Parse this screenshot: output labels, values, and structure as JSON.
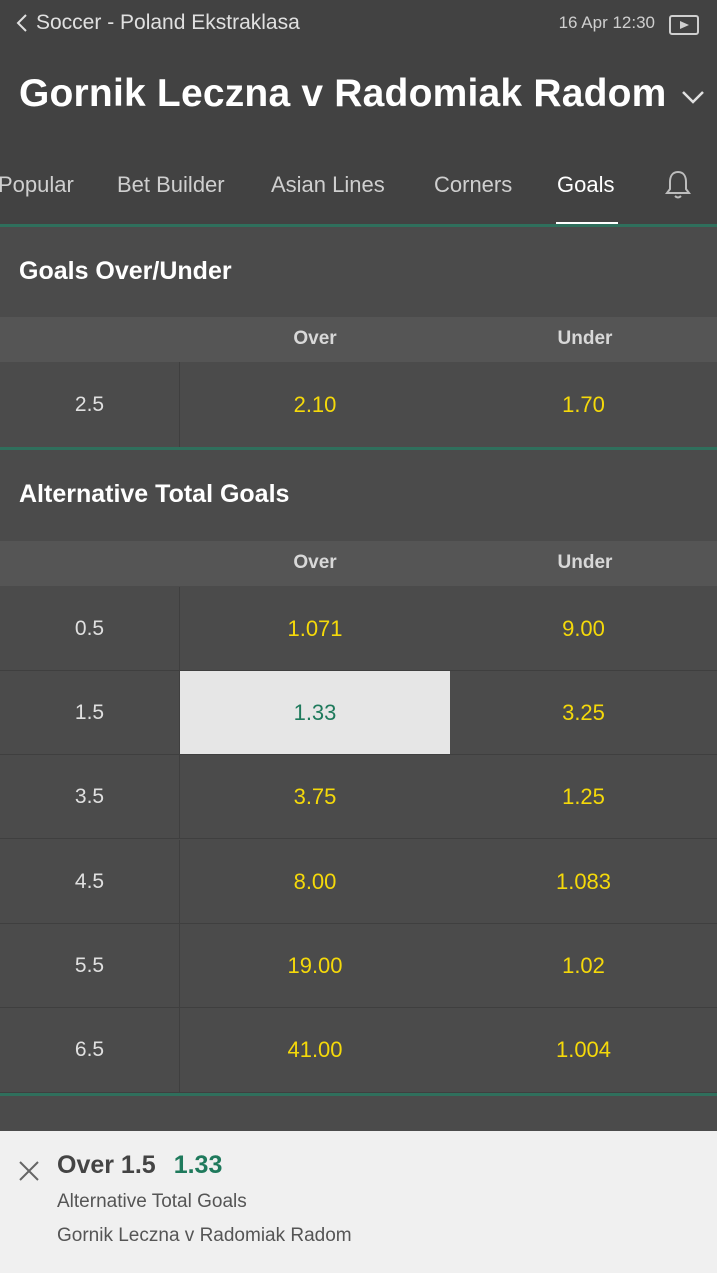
{
  "header": {
    "breadcrumb": "Soccer - Poland Ekstraklasa",
    "datetime": "16 Apr 12:30",
    "match_title": "Gornik Leczna v Radomiak Radom"
  },
  "tabs": [
    {
      "label": "Popular"
    },
    {
      "label": "Bet Builder"
    },
    {
      "label": "Asian Lines"
    },
    {
      "label": "Corners"
    },
    {
      "label": "Goals",
      "active": true
    }
  ],
  "markets": {
    "over_under": {
      "title": "Goals Over/Under",
      "col_over": "Over",
      "col_under": "Under",
      "rows": [
        {
          "line": "2.5",
          "over": "2.10",
          "under": "1.70"
        }
      ]
    },
    "alternative": {
      "title": "Alternative Total Goals",
      "col_over": "Over",
      "col_under": "Under",
      "rows": [
        {
          "line": "0.5",
          "over": "1.071",
          "under": "9.00"
        },
        {
          "line": "1.5",
          "over": "1.33",
          "under": "3.25",
          "selected": "over"
        },
        {
          "line": "3.5",
          "over": "3.75",
          "under": "1.25"
        },
        {
          "line": "4.5",
          "over": "8.00",
          "under": "1.083"
        },
        {
          "line": "5.5",
          "over": "19.00",
          "under": "1.02"
        },
        {
          "line": "6.5",
          "over": "41.00",
          "under": "1.004"
        }
      ]
    }
  },
  "betslip": {
    "selection": "Over 1.5",
    "odds": "1.33",
    "market": "Alternative Total Goals",
    "event": "Gornik Leczna v Radomiak Radom"
  },
  "colors": {
    "odds": "#f5d90a",
    "selected_odds": "#1f7a5c",
    "accent_line": "#2f6f5c"
  }
}
